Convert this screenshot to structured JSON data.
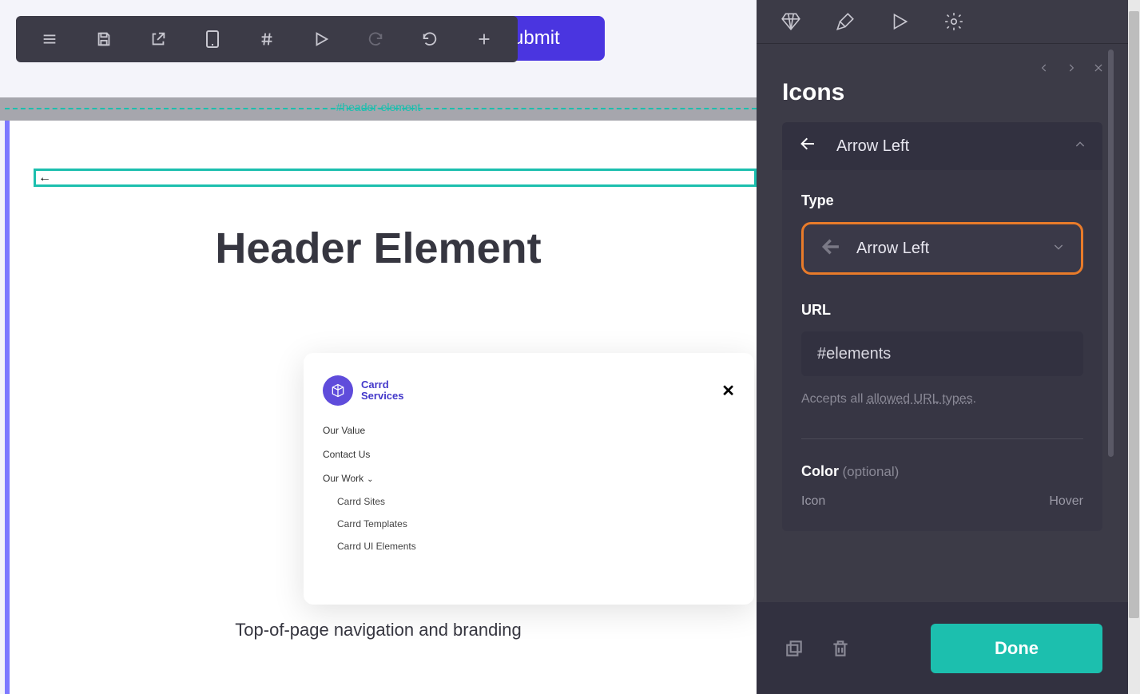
{
  "toolbar": {
    "submit_label": "Submit"
  },
  "canvas": {
    "header_id_label": "#header-element",
    "heading": "Header Element",
    "caption": "Top-of-page navigation and branding"
  },
  "card": {
    "brand_line1": "Carrd",
    "brand_line2": "Services",
    "menu": {
      "our_value": "Our Value",
      "contact_us": "Contact Us",
      "our_work": "Our Work",
      "sub1": "Carrd Sites",
      "sub2": "Carrd Templates",
      "sub3": "Carrd UI Elements"
    }
  },
  "panel": {
    "title": "Icons",
    "accordion_title": "Arrow Left",
    "type_label": "Type",
    "type_value": "Arrow Left",
    "url_label": "URL",
    "url_value": "#elements",
    "url_hint_prefix": "Accepts all ",
    "url_hint_link": "allowed URL types",
    "url_hint_suffix": ".",
    "color_label": "Color",
    "color_optional": "(optional)",
    "color_icon": "Icon",
    "color_hover": "Hover",
    "done_label": "Done"
  }
}
